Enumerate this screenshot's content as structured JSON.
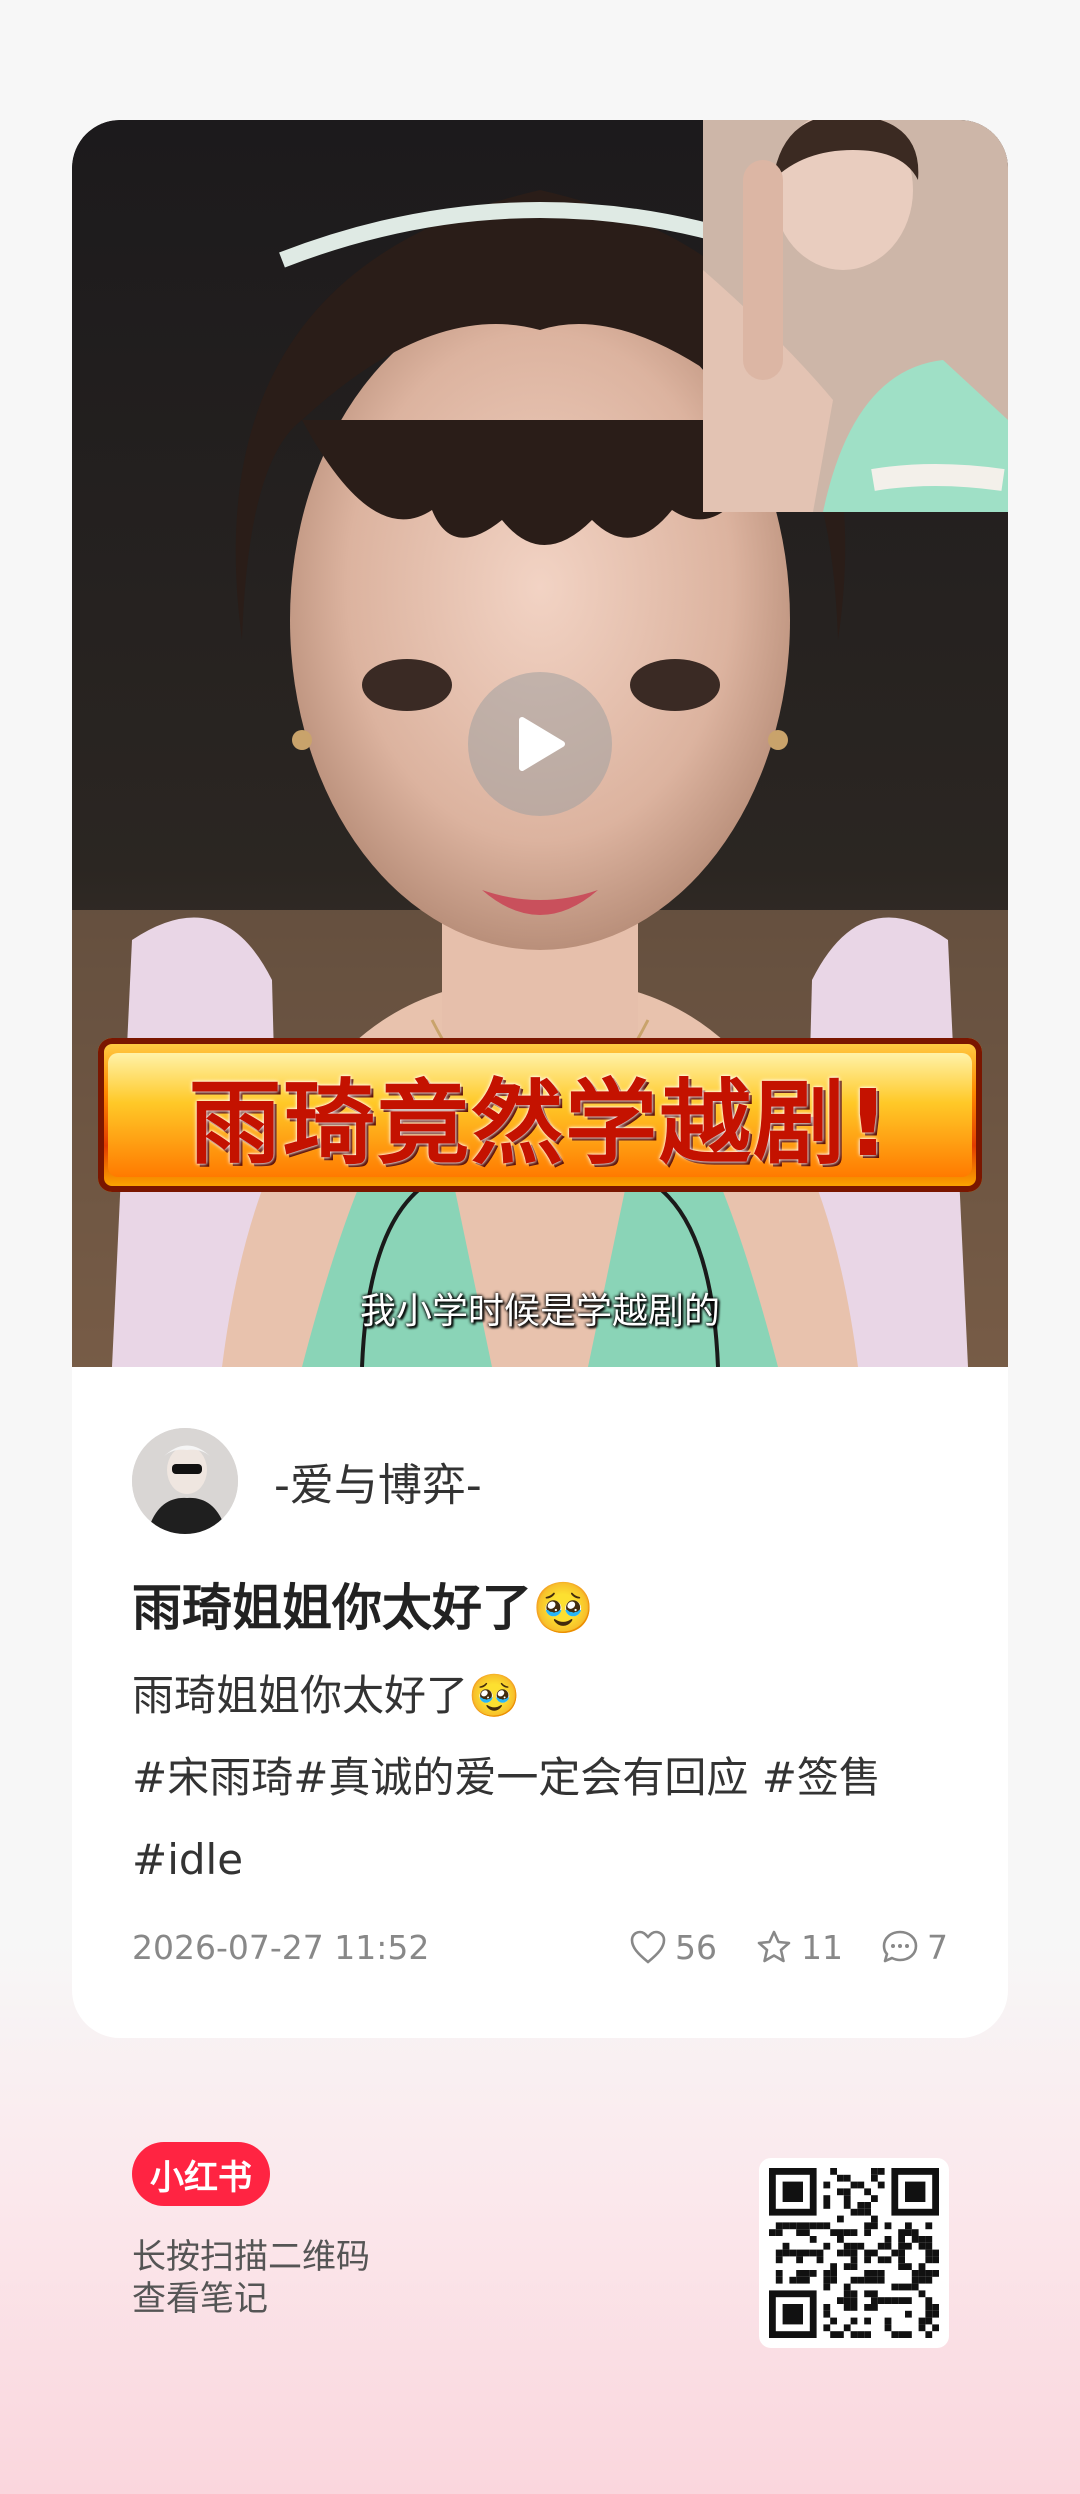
{
  "media": {
    "banner_text": "雨琦竟然学越剧!",
    "subtitle": "我小学时候是学越剧的"
  },
  "author": {
    "name": "-爱与博弈-"
  },
  "note": {
    "title": "雨琦姐姐你太好了🥹",
    "body_line1": "雨琦姐姐你太好了🥹",
    "body_line2": "#宋雨琦#真诚的爱一定会有回应 #签售#idle"
  },
  "meta": {
    "date": "2026-07-27 11:52",
    "likes": "56",
    "favorites": "11",
    "comments": "7"
  },
  "footer": {
    "logo": "小红书",
    "hint_line1": "长按扫描二维码",
    "hint_line2": "查看笔记"
  },
  "icons": {
    "play": "play-icon",
    "like": "heart-icon",
    "favorite": "star-icon",
    "comment": "comment-icon"
  },
  "colors": {
    "brand": "#ff2442",
    "banner_red": "#c41200"
  }
}
